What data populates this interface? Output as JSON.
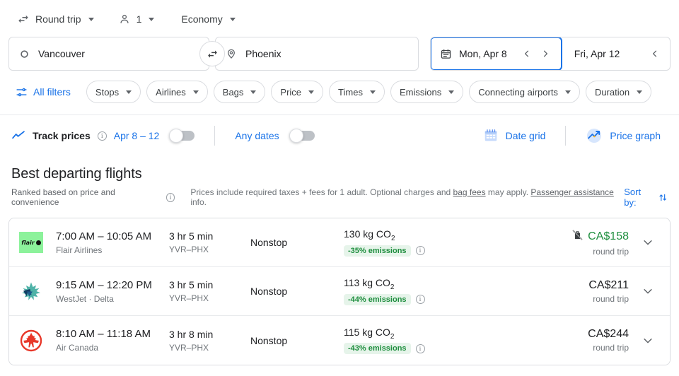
{
  "options": {
    "trip_type": {
      "label": "Round trip",
      "icon": "swap-horizontal-icon"
    },
    "passengers": {
      "label": "1",
      "icon": "person-icon"
    },
    "cabin": {
      "label": "Economy"
    }
  },
  "search": {
    "origin": {
      "value": "Vancouver",
      "icon": "circle-outline-icon"
    },
    "destination": {
      "value": "Phoenix",
      "icon": "map-pin-icon"
    },
    "swap_label": "swap-icon",
    "depart_date": "Mon, Apr 8",
    "return_date": "Fri, Apr 12",
    "prev_arrow": "‹",
    "next_arrow": "›"
  },
  "filters": {
    "all_filters": "All filters",
    "chips": [
      "Stops",
      "Airlines",
      "Bags",
      "Price",
      "Times",
      "Emissions",
      "Connecting airports",
      "Duration"
    ]
  },
  "track": {
    "label": "Track prices",
    "date_range": "Apr 8 – 12",
    "any_dates": "Any dates",
    "date_grid": "Date grid",
    "price_graph": "Price graph",
    "toggle_dates_on": false,
    "toggle_any_on": false
  },
  "results": {
    "title": "Best departing flights",
    "ranked_note": "Ranked based on price and convenience",
    "price_note_1": "Prices include required taxes + fees for 1 adult. Optional charges and ",
    "bag_fees_link": "bag fees",
    "price_note_2": " may apply. ",
    "passenger_assistance_link": "Passenger assistance",
    "price_note_3": " info.",
    "sort_by": "Sort by:"
  },
  "flights": [
    {
      "logo": "flair-logo",
      "logo_text": "flair",
      "times": "7:00 AM – 10:05 AM",
      "carrier": "Flair Airlines",
      "duration": "3 hr 5 min",
      "route": "YVR–PHX",
      "stops": "Nonstop",
      "co2": "130 kg CO",
      "co2_sub": "2",
      "emissions": "-35% emissions",
      "price": "CA$158",
      "price_green": true,
      "no_bag_icon": true,
      "trip_type": "round trip"
    },
    {
      "logo": "westjet-logo",
      "logo_text": "",
      "times": "9:15 AM – 12:20 PM",
      "carrier": "WestJet · Delta",
      "duration": "3 hr 5 min",
      "route": "YVR–PHX",
      "stops": "Nonstop",
      "co2": "113 kg CO",
      "co2_sub": "2",
      "emissions": "-44% emissions",
      "price": "CA$211",
      "price_green": false,
      "no_bag_icon": false,
      "trip_type": "round trip"
    },
    {
      "logo": "aircanada-logo",
      "logo_text": "",
      "times": "8:10 AM – 11:18 AM",
      "carrier": "Air Canada",
      "duration": "3 hr 8 min",
      "route": "YVR–PHX",
      "stops": "Nonstop",
      "co2": "115 kg CO",
      "co2_sub": "2",
      "emissions": "-43% emissions",
      "price": "CA$244",
      "price_green": false,
      "no_bag_icon": false,
      "trip_type": "round trip"
    }
  ],
  "colors": {
    "accent_blue": "#1a73e8",
    "green_price": "#1e8e3e",
    "badge_bg": "#e6f4ea",
    "flair_green": "#8cf29b",
    "air_canada_red": "#e8382a",
    "westjet_teal": "#2a9d8f"
  }
}
